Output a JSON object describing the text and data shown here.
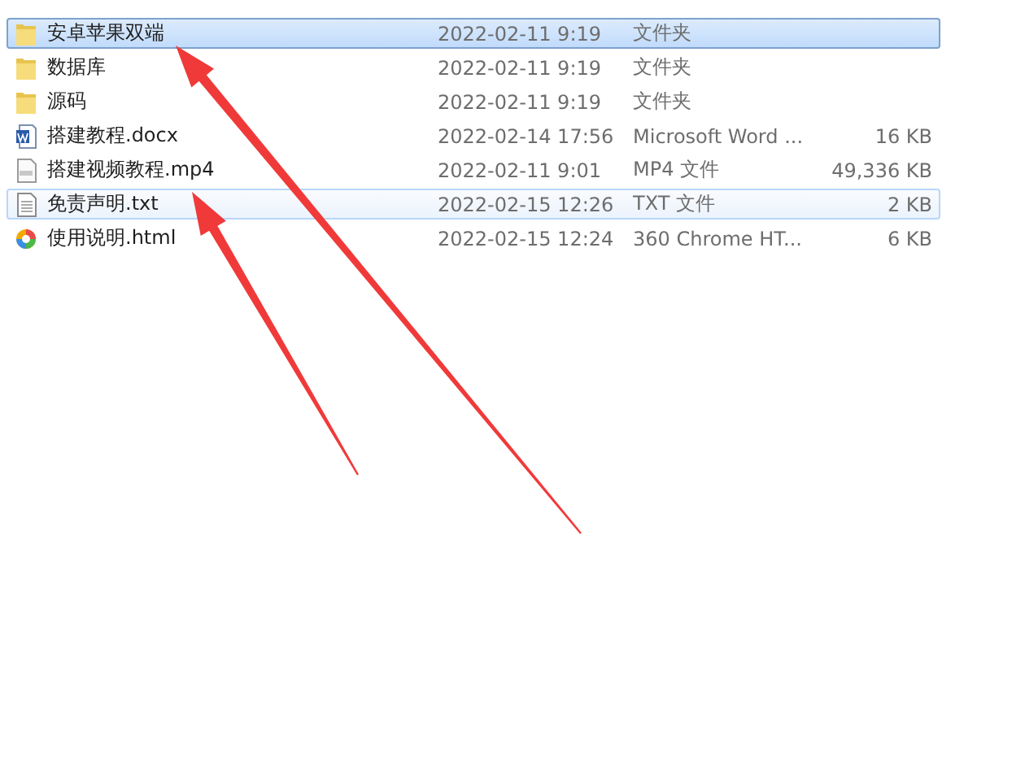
{
  "files": [
    {
      "kind": "folder",
      "name": "安卓苹果双端",
      "modified": "2022-02-11 9:19",
      "type": "文件夹",
      "selected": true,
      "hovered": false
    },
    {
      "kind": "folder",
      "name": "数据库",
      "modified": "2022-02-11 9:19",
      "type": "文件夹",
      "selected": false,
      "hovered": false
    },
    {
      "kind": "folder",
      "name": "源码",
      "modified": "2022-02-11 9:19",
      "type": "文件夹",
      "selected": false,
      "hovered": false
    },
    {
      "kind": "word",
      "name": "搭建教程.docx",
      "modified": "2022-02-14 17:56",
      "type": "Microsoft Word ...",
      "size": "16 KB",
      "selected": false,
      "hovered": false
    },
    {
      "kind": "video",
      "name": "搭建视频教程.mp4",
      "modified": "2022-02-11 9:01",
      "type": "MP4 文件",
      "size": "49,336 KB",
      "selected": false,
      "hovered": false
    },
    {
      "kind": "text",
      "name": "免责声明.txt",
      "modified": "2022-02-15 12:26",
      "type": "TXT 文件",
      "size": "2 KB",
      "selected": false,
      "hovered": true
    },
    {
      "kind": "html",
      "name": "使用说明.html",
      "modified": "2022-02-15 12:24",
      "type": "360 Chrome HT...",
      "size": "6 KB",
      "selected": false,
      "hovered": false
    }
  ]
}
